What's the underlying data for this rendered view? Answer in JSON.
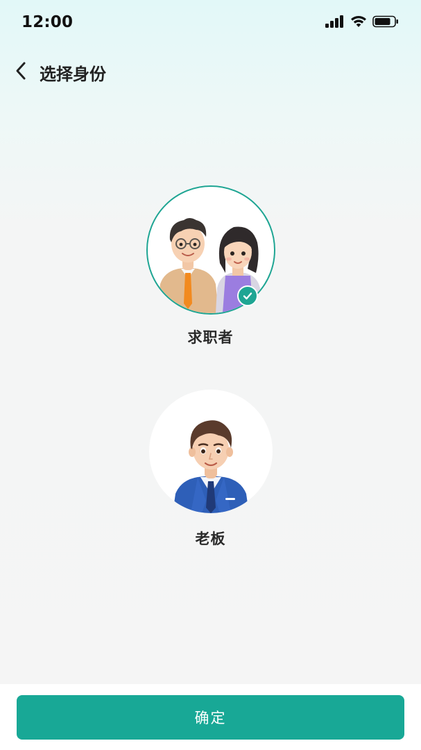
{
  "status_bar": {
    "time": "12:00",
    "icons": [
      "cellular-signal-icon",
      "wifi-icon",
      "battery-icon"
    ]
  },
  "header": {
    "back_icon": "chevron-left-icon",
    "title": "选择身份"
  },
  "roles": [
    {
      "label": "求职者",
      "selected": true,
      "avatar": "job-seeker-couple-avatar"
    },
    {
      "label": "老板",
      "selected": false,
      "avatar": "boss-avatar"
    }
  ],
  "confirm_button": {
    "label": "确定"
  },
  "colors": {
    "accent": "#18a896",
    "selected_ring": "#1ea593",
    "background": "#f5f5f5",
    "header_tint": "#e2f8f8"
  }
}
